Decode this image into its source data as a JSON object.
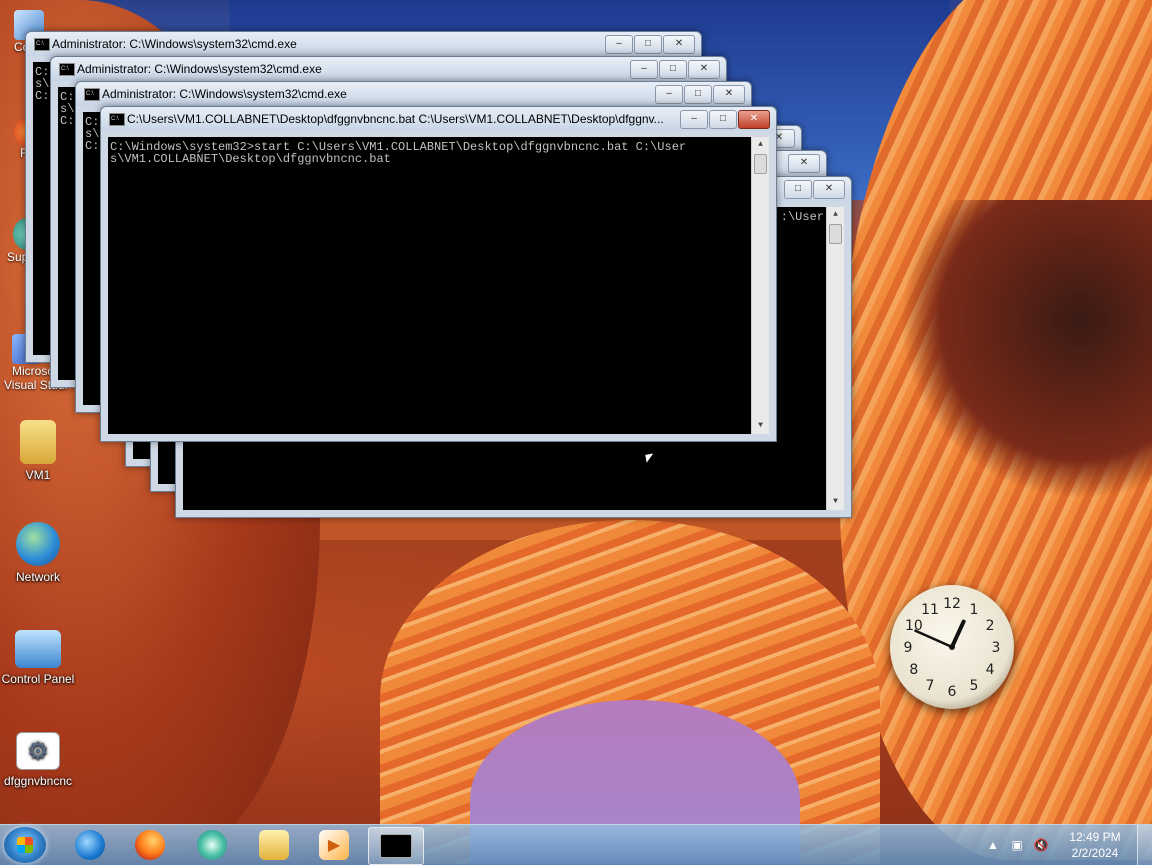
{
  "desktop": {
    "partial_icon_labels": [
      "Co",
      "F",
      "Sup",
      "Microso",
      "Visual Studi"
    ],
    "icons": [
      {
        "label": "VM1",
        "icon": "folder-user-icon"
      },
      {
        "label": "Network",
        "icon": "network-globe-icon"
      },
      {
        "label": "Control Panel",
        "icon": "control-panel-icon"
      },
      {
        "label": "dfggnvbncnc",
        "icon": "batch-file-gear-icon"
      }
    ]
  },
  "windows": {
    "back1_title": "Administrator: C:\\Windows\\system32\\cmd.exe",
    "back2_title": "Administrator: C:\\Windows\\system32\\cmd.exe",
    "back3_title": "Administrator: C:\\Windows\\system32\\cmd.exe",
    "front_title": "C:\\Users\\VM1.COLLABNET\\Desktop\\dfggnvbncnc.bat   C:\\Users\\VM1.COLLABNET\\Desktop\\dfggnv...",
    "front_console": "C:\\Windows\\system32>start C:\\Users\\VM1.COLLABNET\\Desktop\\dfggnvbncnc.bat C:\\User\ns\\VM1.COLLABNET\\Desktop\\dfggnvbncnc.bat",
    "behind_console_fragment": ":\\User",
    "back_fragments": [
      "C:",
      "s\\",
      "C:",
      "C:",
      "s\\",
      "C:",
      "C:",
      "s\\",
      "C:"
    ],
    "buttons": {
      "minimize": "–",
      "maximize": "□",
      "close": "✕"
    }
  },
  "taskbar": {
    "apps": [
      {
        "name": "internet-explorer",
        "icon": "internet-explorer-icon"
      },
      {
        "name": "firefox",
        "icon": "firefox-icon"
      },
      {
        "name": "app-swirl",
        "icon": "swirl-app-icon"
      },
      {
        "name": "file-explorer",
        "icon": "file-explorer-icon"
      },
      {
        "name": "media-player",
        "icon": "media-player-icon"
      },
      {
        "name": "cmd",
        "icon": "cmd-icon"
      }
    ],
    "time": "12:49 PM",
    "date": "2/2/2024",
    "tray_arrow": "▲"
  },
  "clock_gadget": {
    "numbers": [
      "12",
      "1",
      "2",
      "3",
      "4",
      "5",
      "6",
      "7",
      "8",
      "9",
      "10",
      "11"
    ],
    "hour": 12,
    "minute": 49
  },
  "colors": {
    "console_bg": "#000000",
    "console_fg": "#c0c0c0",
    "close_red": "#c0412a"
  }
}
